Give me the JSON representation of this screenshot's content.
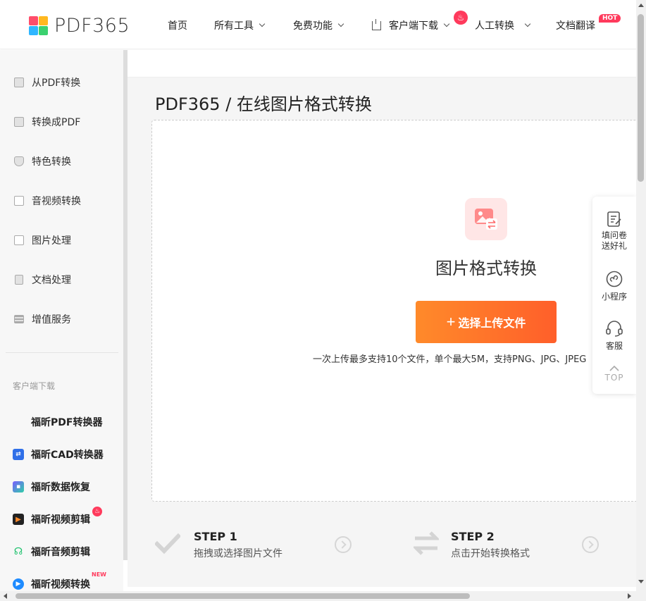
{
  "header": {
    "logo_text": "PDF365",
    "nav": [
      {
        "label": "首页"
      },
      {
        "label": "所有工具"
      },
      {
        "label": "免费功能"
      },
      {
        "label": "客户端下载"
      },
      {
        "label": "人工转换"
      },
      {
        "label": "文档翻译"
      }
    ],
    "hot_badge": "HOT"
  },
  "sidebar": {
    "items": [
      {
        "label": "从PDF转换"
      },
      {
        "label": "转换成PDF"
      },
      {
        "label": "特色转换"
      },
      {
        "label": "音视频转换"
      },
      {
        "label": "图片处理"
      },
      {
        "label": "文档处理"
      },
      {
        "label": "增值服务"
      }
    ],
    "download_title": "客户端下载",
    "apps": [
      {
        "label": "福昕PDF转换器"
      },
      {
        "label": "福昕CAD转换器"
      },
      {
        "label": "福昕数据恢复"
      },
      {
        "label": "福昕视频剪辑"
      },
      {
        "label": "福昕音频剪辑"
      },
      {
        "label": "福昕视频转换"
      }
    ],
    "new_badge": "NEW"
  },
  "main": {
    "breadcrumb": "PDF365 / 在线图片格式转换",
    "tool_title": "图片格式转换",
    "upload_button": "选择上传文件",
    "upload_hint": "一次上传最多支持10个文件，单个最大5M，支持PNG、JPG、JPEG",
    "steps": [
      {
        "title": "STEP 1",
        "desc": "拖拽或选择图片文件"
      },
      {
        "title": "STEP 2",
        "desc": "点击开始转换格式"
      }
    ]
  },
  "float_panel": {
    "survey": "填问卷\n送好礼",
    "miniapp": "小程序",
    "service": "客服",
    "top": "TOP"
  },
  "colors": {
    "accent": "#ff6a2a",
    "hot": "#ff3a5c"
  }
}
